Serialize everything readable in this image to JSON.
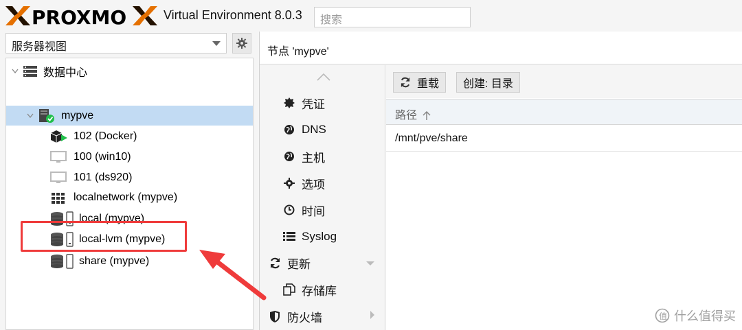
{
  "header": {
    "logo_text": "PROXMOX",
    "product_title": "Virtual Environment 8.0.3",
    "search_placeholder": "搜索"
  },
  "left": {
    "view_select_value": "服务器视图",
    "tree": [
      {
        "label": "数据中心",
        "icon": "datacenter-icon"
      },
      {
        "label": "mypve",
        "icon": "node-online-icon",
        "selected": true
      },
      {
        "label": "102 (Docker)",
        "icon": "container-running-icon"
      },
      {
        "label": "100 (win10)",
        "icon": "vm-stopped-icon"
      },
      {
        "label": "101 (ds920)",
        "icon": "vm-stopped-icon"
      },
      {
        "label": "localnetwork (mypve)",
        "icon": "sdn-icon"
      },
      {
        "label": "local (mypve)",
        "icon": "storage-icon"
      },
      {
        "label": "local-lvm (mypve)",
        "icon": "storage-icon"
      },
      {
        "label": "share (mypve)",
        "icon": "storage-icon"
      }
    ]
  },
  "right": {
    "title": "节点 'mypve'",
    "menu": [
      {
        "label": "凭证",
        "icon": "certificate-icon"
      },
      {
        "label": "DNS",
        "icon": "globe-icon"
      },
      {
        "label": "主机",
        "icon": "globe-icon"
      },
      {
        "label": "选项",
        "icon": "gear-icon"
      },
      {
        "label": "时间",
        "icon": "clock-icon"
      },
      {
        "label": "Syslog",
        "icon": "list-icon"
      },
      {
        "label": "更新",
        "icon": "refresh-icon"
      },
      {
        "label": "存储库",
        "icon": "copy-icon"
      },
      {
        "label": "防火墙",
        "icon": "shield-icon"
      }
    ],
    "toolbar": {
      "reload_label": "重载",
      "create_label": "创建: 目录"
    },
    "grid": {
      "column_path": "路径",
      "rows": [
        "/mnt/pve/share"
      ]
    }
  },
  "watermark": "什么值得买",
  "colors": {
    "logo_orange": "#e57000",
    "selected_row": "#c2dbf3",
    "annotation_red": "#ef3b3b"
  }
}
